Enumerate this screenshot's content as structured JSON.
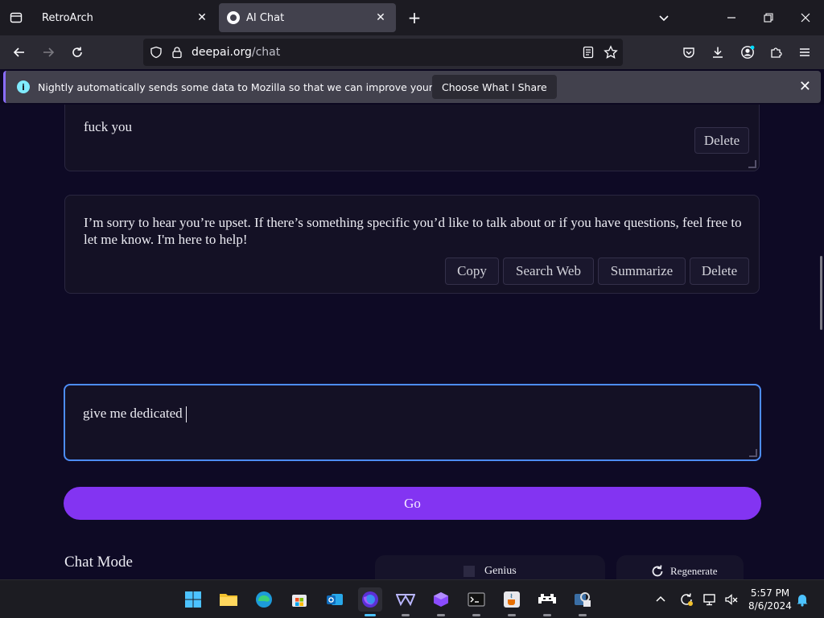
{
  "browser": {
    "tabs": [
      {
        "label": "RetroArch",
        "active": false
      },
      {
        "label": "AI Chat",
        "active": true
      }
    ],
    "url_host": "deepai.org",
    "url_path": "/chat"
  },
  "notification": {
    "message": "Nightly automatically sends some data to Mozilla so that we can improve your experience.",
    "button": "Choose What I Share"
  },
  "chat": {
    "messages": [
      {
        "role": "user",
        "text": "fuck you",
        "actions": [
          "Delete"
        ]
      },
      {
        "role": "assistant",
        "text": "I’m sorry to hear you’re upset. If there’s something specific you’d like to talk about or if you have questions, feel free to let me know. I'm here to help!",
        "actions": [
          "Copy",
          "Search Web",
          "Summarize",
          "Delete"
        ]
      }
    ],
    "input_value": "give me dedicated",
    "go_label": "Go",
    "chat_mode_label": "Chat Mode",
    "genius_label": "Genius",
    "regenerate_label": "Regenerate"
  },
  "taskbar": {
    "time": "5:57 PM",
    "date": "8/6/2024"
  },
  "colors": {
    "accent": "#8334f2",
    "focus_border": "#4d8df7",
    "background": "#0e0a25"
  }
}
